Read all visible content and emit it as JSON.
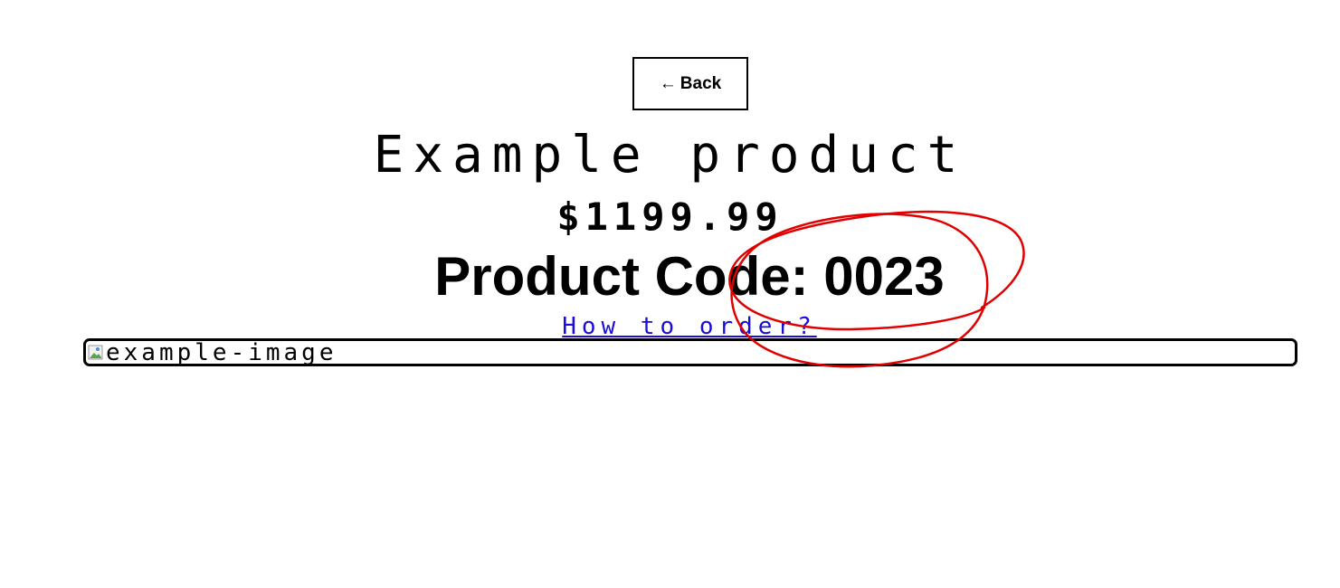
{
  "back_button": {
    "arrow": "←",
    "label": "Back"
  },
  "product": {
    "title": "Example product",
    "price": "$1199.99",
    "code_text": "Product Code: 0023",
    "order_link": "How to order?",
    "image_alt": "example-image"
  },
  "annotation": {
    "color": "#e00000",
    "shape": "hand-drawn-ellipses"
  },
  "icons": {
    "back": "left-arrow-icon",
    "image": "broken-image-icon"
  }
}
